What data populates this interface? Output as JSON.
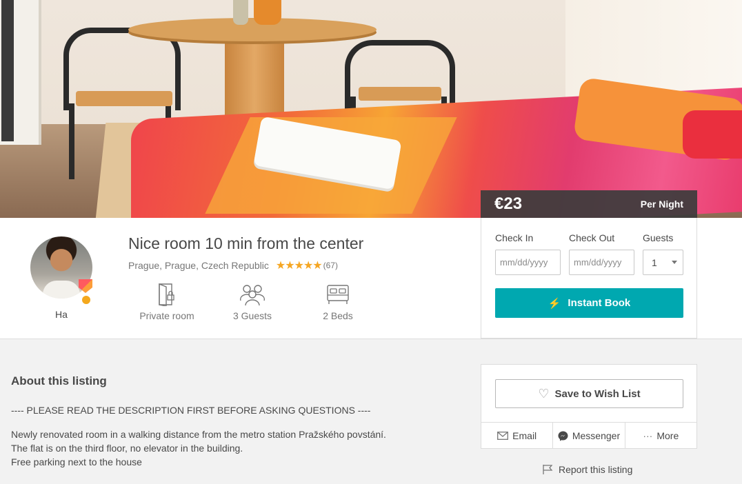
{
  "listing": {
    "title": "Nice room 10 min from the center",
    "location": "Prague, Prague, Czech Republic",
    "stars": "★★★★★",
    "review_count": "(67)",
    "host_name": "Ha"
  },
  "features": [
    {
      "label": "Private room",
      "icon": "door-icon"
    },
    {
      "label": "3 Guests",
      "icon": "guests-icon"
    },
    {
      "label": "2 Beds",
      "icon": "bed-icon"
    }
  ],
  "price": {
    "amount": "€23",
    "period": "Per Night"
  },
  "booking": {
    "check_in_label": "Check In",
    "check_out_label": "Check Out",
    "guests_label": "Guests",
    "date_placeholder": "mm/dd/yyyy",
    "guests_value": "1",
    "book_label": "Instant Book"
  },
  "about": {
    "heading": "About this listing",
    "lines": [
      "---- PLEASE READ THE DESCRIPTION FIRST BEFORE ASKING QUESTIONS ----",
      "Newly renovated room in a walking distance from the metro station Pražského povstání.",
      "The flat is on the third floor, no elevator in the building.",
      "Free parking next to the house"
    ]
  },
  "share": {
    "wish_list_label": "Save to Wish List",
    "email_label": "Email",
    "messenger_label": "Messenger",
    "more_label": "More",
    "report_label": "Report this listing"
  },
  "colors": {
    "accent": "#00a8b0",
    "star": "#f5a623",
    "link": "#ff5a5f"
  }
}
